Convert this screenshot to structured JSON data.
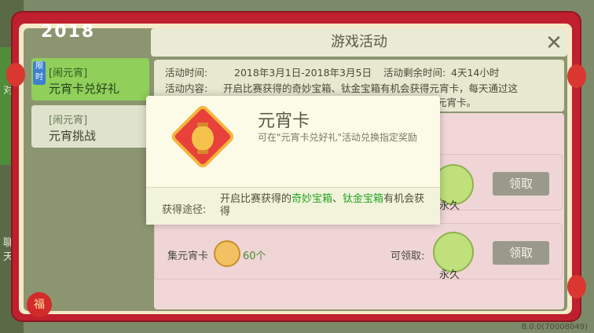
{
  "window": {
    "title": "游戏活动",
    "close_icon": "close-icon"
  },
  "side": {
    "top_char": "对",
    "bottom_chars": [
      "聊",
      "天"
    ]
  },
  "tabs": [
    {
      "badge": "限时",
      "tag": "[闹元宵]",
      "label": "元宵卡兑好礼",
      "active": true
    },
    {
      "tag": "[闹元宵]",
      "label": "元宵挑战",
      "active": false
    }
  ],
  "activity": {
    "time_label": "活动时间:",
    "time_value": "2018年3月1日-2018年3月5日",
    "remaining_label": "活动剩余时间:",
    "remaining_value": "4天14小时",
    "content_label": "活动内容:",
    "content_value_1": "开启比赛获得的奇妙宝箱、钛金宝箱有机会获得元宵卡，每天通过这",
    "content_value_2": "元宵卡。"
  },
  "rows": [
    {
      "label": "",
      "available_label": "",
      "reward_text": "永久",
      "claim_label": "领取"
    },
    {
      "label": "集元宵卡",
      "count": "60个",
      "available_label": "可领取:",
      "reward_text": "永久",
      "claim_label": "领取"
    }
  ],
  "popup": {
    "title": "元宵卡",
    "description": "可在\"元宵卡兑好礼\"活动兑换指定奖励",
    "get_label": "获得途径:",
    "get_text_prefix": "开启比赛获得的",
    "get_highlight_1": "奇妙宝箱",
    "get_sep": "、",
    "get_highlight_2": "钛金宝箱",
    "get_text_suffix": "有机会获得"
  },
  "decor": {
    "banner": "2018",
    "fu": "福"
  },
  "version": "8.0.0(70008049)",
  "colors": {
    "frame_red": "#c0202e",
    "active_tab": "#8fcf5a",
    "highlight_green": "#27a326",
    "claim_button": "#9a9a8c"
  }
}
